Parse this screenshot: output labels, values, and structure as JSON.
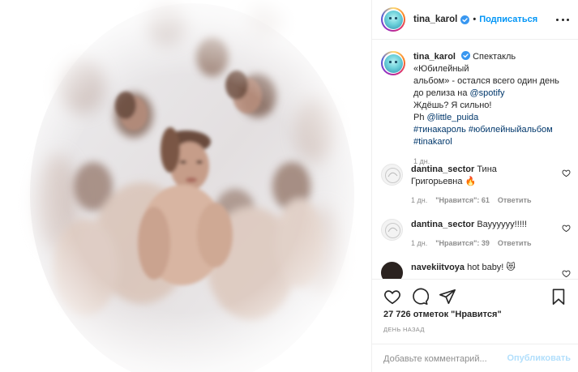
{
  "post": {
    "author": "tina_karol",
    "follow_label": "Подписаться",
    "dot": "•",
    "colors": {
      "accent": "#0095f6",
      "verified": "#3897f0",
      "link": "#00376b",
      "muted": "#8e8e8e"
    }
  },
  "caption": {
    "username": "tina_karol",
    "line1": "Спектакль «Юбилейный",
    "line2": "альбом» - остался всего один день",
    "line3": "до релиза на ",
    "mention_spotify": "@spotify",
    "line4": "Ждёшь? Я сильно!",
    "line5_prefix": "Ph ",
    "mention_photographer": "@little_puida",
    "hashtags_line1": "#тинакароль #юбилейныйальбом",
    "hashtags_line2": "#tinakarol",
    "time": "1 дн."
  },
  "comments": [
    {
      "username": "dantina_sector",
      "text_a": "Тина",
      "text_b": "Григорьевна 🔥",
      "time": "1 дн.",
      "likes": "\"Нравится\": 61",
      "reply": "Ответить"
    },
    {
      "username": "dantina_sector",
      "text_a": "Вауууууу!!!!!",
      "text_b": "",
      "time": "1 дн.",
      "likes": "\"Нравится\": 39",
      "reply": "Ответить"
    },
    {
      "username": "navekiitvoya",
      "text_a": "hot baby! 😻",
      "text_b": "",
      "time": "",
      "likes": "",
      "reply": ""
    }
  ],
  "actions": {
    "icons": [
      "heart-icon",
      "comment-icon",
      "share-icon",
      "bookmark-icon"
    ],
    "likes_text": "27 726 отметок \"Нравится\"",
    "date_text": "ДЕНЬ НАЗАД",
    "comment_placeholder": "Добавьте комментарий...",
    "publish_label": "Опубликовать"
  }
}
